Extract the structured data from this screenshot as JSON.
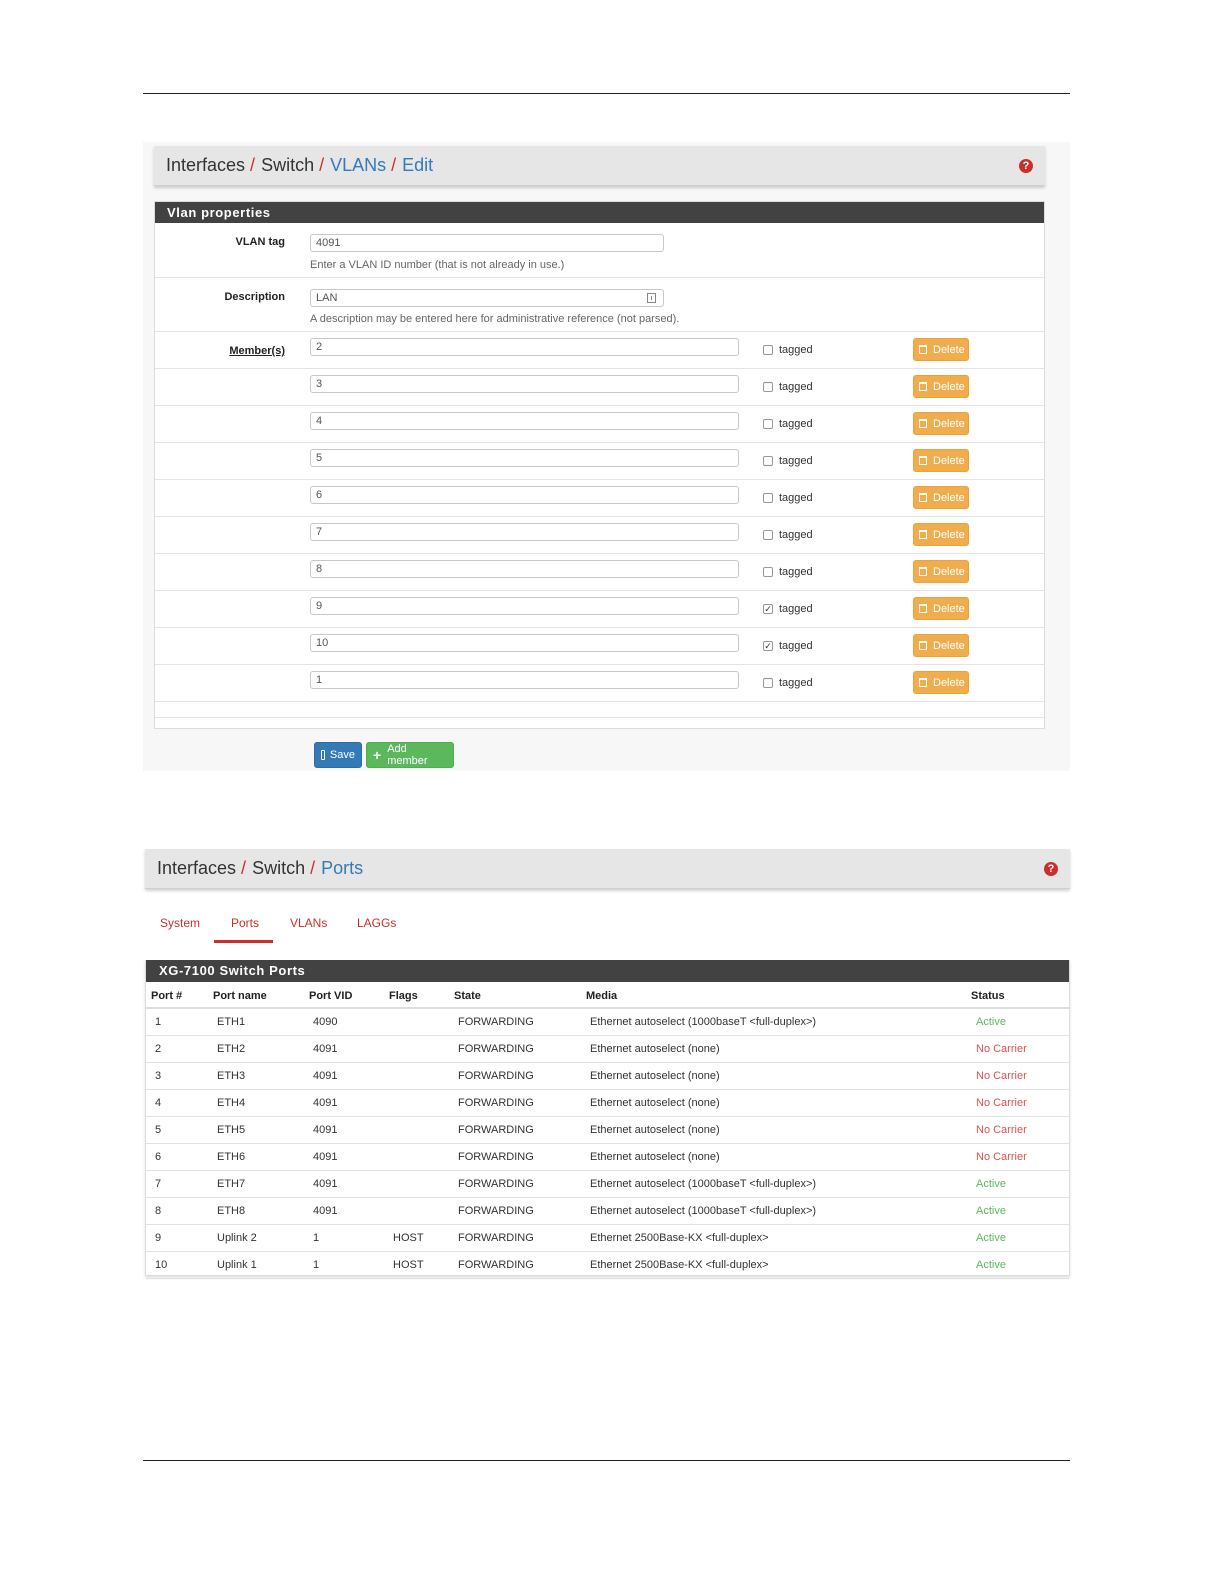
{
  "vlan_edit": {
    "breadcrumb": [
      {
        "label": "Interfaces",
        "link": false
      },
      {
        "label": "Switch",
        "link": false
      },
      {
        "label": "VLANs",
        "link": true
      },
      {
        "label": "Edit",
        "link": true
      }
    ],
    "help_icon": "?",
    "panel_title": "Vlan properties",
    "vlan_tag": {
      "label": "VLAN tag",
      "value": "4091",
      "help": "Enter a VLAN ID number (that is not already in use.)"
    },
    "description": {
      "label": "Description",
      "value": "LAN",
      "help": "A description may be entered here for administrative reference (not parsed)."
    },
    "members_label": "Member(s)",
    "tagged_label": "tagged",
    "delete_label": "Delete",
    "members": [
      {
        "port": "2",
        "tagged": false
      },
      {
        "port": "3",
        "tagged": false
      },
      {
        "port": "4",
        "tagged": false
      },
      {
        "port": "5",
        "tagged": false
      },
      {
        "port": "6",
        "tagged": false
      },
      {
        "port": "7",
        "tagged": false
      },
      {
        "port": "8",
        "tagged": false
      },
      {
        "port": "9",
        "tagged": true
      },
      {
        "port": "10",
        "tagged": true
      },
      {
        "port": "1",
        "tagged": false
      }
    ],
    "save_label": "Save",
    "add_member_label": "Add member"
  },
  "ports": {
    "breadcrumb": [
      {
        "label": "Interfaces",
        "link": false
      },
      {
        "label": "Switch",
        "link": false
      },
      {
        "label": "Ports",
        "link": true
      }
    ],
    "help_icon": "?",
    "tabs": [
      {
        "label": "System",
        "active": false
      },
      {
        "label": "Ports",
        "active": true
      },
      {
        "label": "VLANs",
        "active": false
      },
      {
        "label": "LAGGs",
        "active": false
      }
    ],
    "table_title": "XG-7100 Switch Ports",
    "columns": [
      "Port #",
      "Port name",
      "Port VID",
      "Flags",
      "State",
      "Media",
      "Status"
    ],
    "rows": [
      {
        "port": "1",
        "name": "ETH1",
        "vid": "4090",
        "flags": "",
        "state": "FORWARDING",
        "media": "Ethernet autoselect (1000baseT <full-duplex>)",
        "status": "Active"
      },
      {
        "port": "2",
        "name": "ETH2",
        "vid": "4091",
        "flags": "",
        "state": "FORWARDING",
        "media": "Ethernet autoselect (none)",
        "status": "No Carrier"
      },
      {
        "port": "3",
        "name": "ETH3",
        "vid": "4091",
        "flags": "",
        "state": "FORWARDING",
        "media": "Ethernet autoselect (none)",
        "status": "No Carrier"
      },
      {
        "port": "4",
        "name": "ETH4",
        "vid": "4091",
        "flags": "",
        "state": "FORWARDING",
        "media": "Ethernet autoselect (none)",
        "status": "No Carrier"
      },
      {
        "port": "5",
        "name": "ETH5",
        "vid": "4091",
        "flags": "",
        "state": "FORWARDING",
        "media": "Ethernet autoselect (none)",
        "status": "No Carrier"
      },
      {
        "port": "6",
        "name": "ETH6",
        "vid": "4091",
        "flags": "",
        "state": "FORWARDING",
        "media": "Ethernet autoselect (none)",
        "status": "No Carrier"
      },
      {
        "port": "7",
        "name": "ETH7",
        "vid": "4091",
        "flags": "",
        "state": "FORWARDING",
        "media": "Ethernet autoselect (1000baseT <full-duplex>)",
        "status": "Active"
      },
      {
        "port": "8",
        "name": "ETH8",
        "vid": "4091",
        "flags": "",
        "state": "FORWARDING",
        "media": "Ethernet autoselect (1000baseT <full-duplex>)",
        "status": "Active"
      },
      {
        "port": "9",
        "name": "Uplink 2",
        "vid": "1",
        "flags": "HOST",
        "state": "FORWARDING",
        "media": "Ethernet 2500Base-KX <full-duplex>",
        "status": "Active"
      },
      {
        "port": "10",
        "name": "Uplink 1",
        "vid": "1",
        "flags": "HOST",
        "state": "FORWARDING",
        "media": "Ethernet 2500Base-KX <full-duplex>",
        "status": "Active"
      }
    ]
  },
  "colors": {
    "active": "#5cb85c",
    "no_carrier": "#d9534f",
    "accent_red": "#c9302c",
    "link_blue": "#337ab7",
    "delete_orange": "#f0ad4e",
    "save_blue": "#337ab7",
    "add_green": "#5cb85c"
  }
}
